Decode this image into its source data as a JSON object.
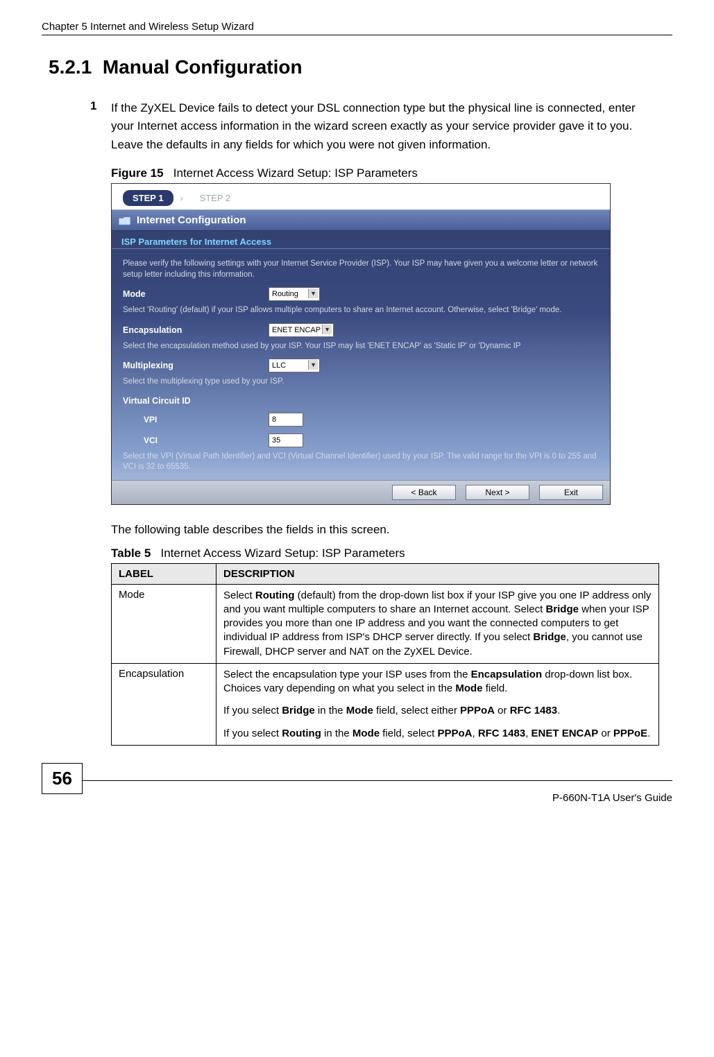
{
  "header": {
    "chapter_title": "Chapter 5 Internet and Wireless Setup Wizard"
  },
  "section": {
    "number": "5.2.1",
    "title": "Manual Configuration"
  },
  "step": {
    "number": "1",
    "text": "If the ZyXEL Device fails to detect your DSL connection type but the physical line is connected, enter your Internet access information in the wizard screen exactly as your service provider gave it to you. Leave the defaults in any fields for which you were not given information."
  },
  "figure": {
    "label": "Figure 15",
    "caption": "Internet Access Wizard Setup: ISP Parameters"
  },
  "wizard": {
    "steps": {
      "step1": "STEP 1",
      "step2": "STEP 2"
    },
    "title": "Internet Configuration",
    "section_heading": "ISP Parameters for Internet Access",
    "intro": "Please verify the following settings with your Internet Service Provider (ISP). Your ISP may have given you a welcome letter or network setup letter including this information.",
    "mode": {
      "label": "Mode",
      "value": "Routing",
      "help": "Select 'Routing' (default) if your ISP allows multiple computers to share an Internet account. Otherwise, select 'Bridge' mode."
    },
    "encap": {
      "label": "Encapsulation",
      "value": "ENET ENCAP",
      "help": "Select the encapsulation method used by your ISP. Your ISP may list 'ENET ENCAP' as 'Static IP' or 'Dynamic IP"
    },
    "mux": {
      "label": "Multiplexing",
      "value": "LLC",
      "help": "Select the multiplexing type used by your ISP."
    },
    "vc": {
      "heading": "Virtual Circuit ID",
      "vpi_label": "VPI",
      "vpi_value": "8",
      "vci_label": "VCI",
      "vci_value": "35",
      "help": "Select the VPI (Virtual Path Identifier) and VCI (Virtual Channel Identifier) used by your ISP. The valid range for the VPI is 0 to 255 and VCI is 32 to 65535."
    },
    "buttons": {
      "back": "< Back",
      "next": "Next >",
      "exit": "Exit"
    }
  },
  "post_figure_text": "The following table describes the fields in this screen.",
  "table": {
    "label": "Table 5",
    "caption": "Internet Access Wizard Setup: ISP Parameters",
    "headers": {
      "col1": "LABEL",
      "col2": "DESCRIPTION"
    },
    "rows": [
      {
        "label": "Mode",
        "desc_parts": {
          "p1_a": "Select ",
          "p1_b_bold": "Routing",
          "p1_c": " (default) from the drop-down list box if your ISP give you one IP address only and you want multiple computers to share an Internet account. Select ",
          "p1_d_bold": "Bridge",
          "p1_e": " when your ISP provides you more than one IP address and you want the connected computers to get individual IP address from ISP's DHCP server directly. If you select ",
          "p1_f_bold": "Bridge",
          "p1_g": ", you cannot use Firewall, DHCP server and NAT on the ZyXEL Device."
        }
      },
      {
        "label": "Encapsulation",
        "desc_parts": {
          "p1_a": "Select the encapsulation type your ISP uses from the ",
          "p1_b_bold": "Encapsulation",
          "p1_c": " drop-down list box. Choices vary depending on what you select in the ",
          "p1_d_bold": "Mode",
          "p1_e": " field.",
          "p2_a": "If you select ",
          "p2_b_bold": "Bridge",
          "p2_c": " in the ",
          "p2_d_bold": "Mode",
          "p2_e": " field, select either ",
          "p2_f_bold": "PPPoA",
          "p2_g": " or ",
          "p2_h_bold": "RFC 1483",
          "p2_i": ".",
          "p3_a": "If you select ",
          "p3_b_bold": "Routing",
          "p3_c": " in the ",
          "p3_d_bold": "Mode",
          "p3_e": " field, select ",
          "p3_f_bold": "PPPoA",
          "p3_g": ", ",
          "p3_h_bold": "RFC 1483",
          "p3_i": ", ",
          "p3_j_bold": "ENET ENCAP",
          "p3_k": " or ",
          "p3_l_bold": "PPPoE",
          "p3_m": "."
        }
      }
    ]
  },
  "footer": {
    "page_number": "56",
    "guide_title": "P-660N-T1A User's Guide"
  }
}
